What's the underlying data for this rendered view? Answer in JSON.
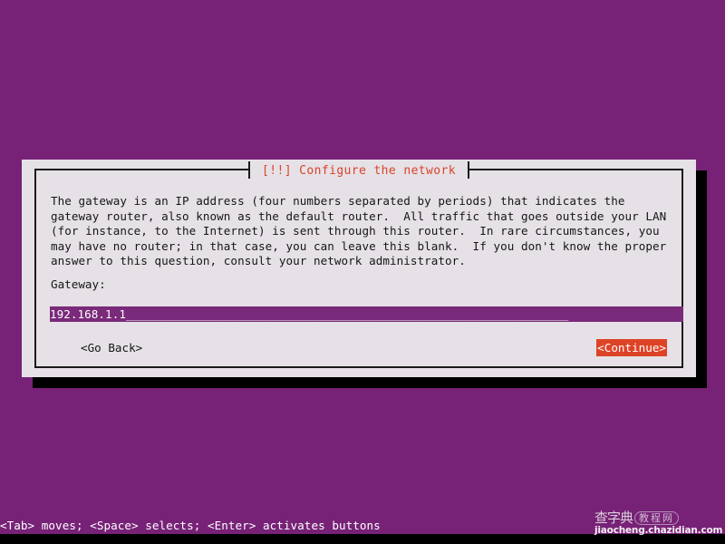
{
  "screen": {
    "background_color": "#772277",
    "bottom_strip_color": "#000000"
  },
  "dialog": {
    "title": "[!!] Configure the network",
    "title_color": "#d9442b",
    "background_color": "#e6e1e6",
    "border_color": "#1a1a1a",
    "shadow_color": "#000000",
    "body_text": "The gateway is an IP address (four numbers separated by periods) that indicates the\ngateway router, also known as the default router.  All traffic that goes outside your LAN\n(for instance, to the Internet) is sent through this router.  In rare circumstances, you\nmay have no router; in that case, you can leave this blank.  If you don't know the proper\nanswer to this question, consult your network administrator.",
    "field_label": "Gateway:",
    "gateway_value": "192.168.1.1________________________________________________________________",
    "gateway_placeholder": "192.168.1.1",
    "gateway_field_bg": "#7a2a7a",
    "gateway_field_fg": "#ffffff",
    "buttons": {
      "go_back": "<Go Back>",
      "continue": "<Continue>",
      "continue_bg": "#dd4326",
      "continue_fg": "#ffffff",
      "focused": "continue"
    }
  },
  "help_bar": {
    "text": "<Tab> moves; <Space> selects; <Enter> activates buttons",
    "color": "#ffffff"
  },
  "watermark": {
    "logo_text": "查字典",
    "badge_text": "教程网",
    "url": "jiaocheng.chazidian.com"
  }
}
